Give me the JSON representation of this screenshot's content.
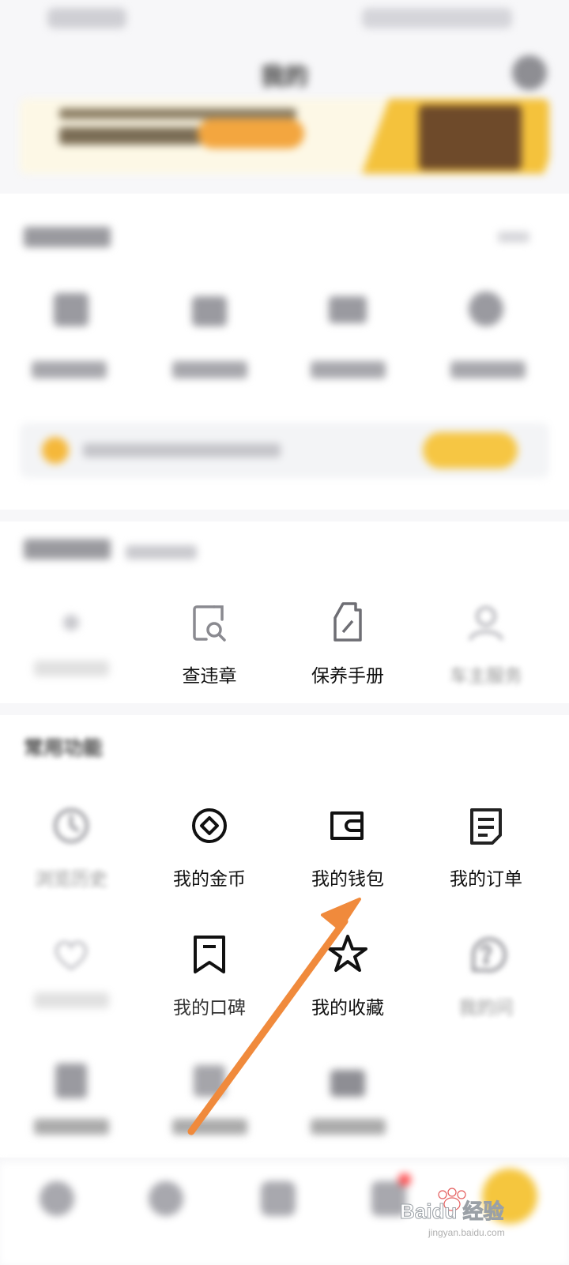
{
  "status_bar": {
    "left": "",
    "right": ""
  },
  "header": {
    "title": "我的"
  },
  "banner": {
    "line": "",
    "cta": ""
  },
  "tools": {
    "title": "",
    "items": [
      {
        "label": "",
        "sub": "",
        "icon": "calendar-icon"
      },
      {
        "label": "",
        "sub": "",
        "icon": "basket-icon"
      },
      {
        "label": "",
        "sub": "",
        "icon": "card-icon"
      },
      {
        "label": "",
        "sub": "",
        "icon": "wheel-icon"
      }
    ]
  },
  "notice": {
    "text": "",
    "button": ""
  },
  "car_service": {
    "title": "",
    "items": [
      {
        "label": "",
        "icon": "plus-icon"
      },
      {
        "label": "查违章",
        "icon": "magnifier-doc-icon"
      },
      {
        "label": "保养手册",
        "icon": "oil-can-icon"
      },
      {
        "label": "车主服务",
        "icon": "person-icon"
      }
    ]
  },
  "common_functions": {
    "title": "常用功能",
    "rows": [
      [
        {
          "label": "浏览历史",
          "icon": "clock-icon"
        },
        {
          "label": "我的金币",
          "icon": "coin-icon"
        },
        {
          "label": "我的钱包",
          "icon": "wallet-icon"
        },
        {
          "label": "我的订单",
          "icon": "order-icon"
        }
      ],
      [
        {
          "label": "",
          "icon": "heart-icon"
        },
        {
          "label": "我的口碑",
          "icon": "bookmark-flag-icon"
        },
        {
          "label": "我的收藏",
          "icon": "star-icon"
        },
        {
          "label": "我的问",
          "icon": "question-bubble-icon"
        }
      ],
      [
        {
          "label": "",
          "icon": "document-icon"
        },
        {
          "label": "",
          "icon": "box-icon"
        },
        {
          "label": "",
          "icon": "tv-icon"
        }
      ]
    ]
  },
  "bottom_nav": {
    "items": [
      "",
      "",
      "",
      ""
    ]
  },
  "watermark": {
    "brand": "Baidu 经验",
    "url": "jingyan.baidu.com"
  },
  "colors": {
    "accent_yellow": "#f6c643",
    "annotation_arrow": "#f08a3c"
  }
}
